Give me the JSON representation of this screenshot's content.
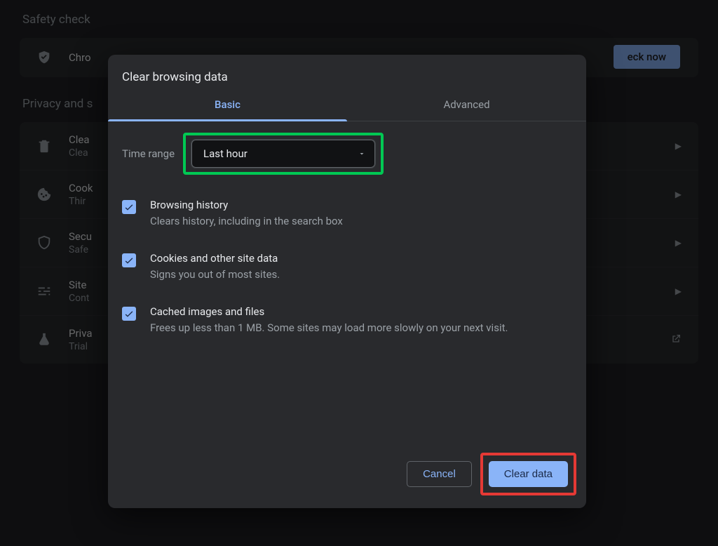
{
  "background": {
    "safety_title": "Safety check",
    "safety_row_text": "Chro",
    "check_now": "eck now",
    "privacy_title": "Privacy and s",
    "rows": [
      {
        "primary": "Clea",
        "secondary": "Clea"
      },
      {
        "primary": "Cook",
        "secondary": "Thir"
      },
      {
        "primary": "Secu",
        "secondary": "Safe"
      },
      {
        "primary": "Site",
        "secondary": "Cont"
      },
      {
        "primary": "Priva",
        "secondary": "Trial"
      }
    ]
  },
  "modal": {
    "title": "Clear browsing data",
    "tabs": {
      "basic": "Basic",
      "advanced": "Advanced"
    },
    "time_label": "Time range",
    "time_value": "Last hour",
    "items": [
      {
        "title": "Browsing history",
        "desc": "Clears history, including in the search box",
        "checked": true
      },
      {
        "title": "Cookies and other site data",
        "desc": "Signs you out of most sites.",
        "checked": true
      },
      {
        "title": "Cached images and files",
        "desc": "Frees up less than 1 MB. Some sites may load more slowly on your next visit.",
        "checked": true
      }
    ],
    "cancel": "Cancel",
    "clear": "Clear data"
  }
}
